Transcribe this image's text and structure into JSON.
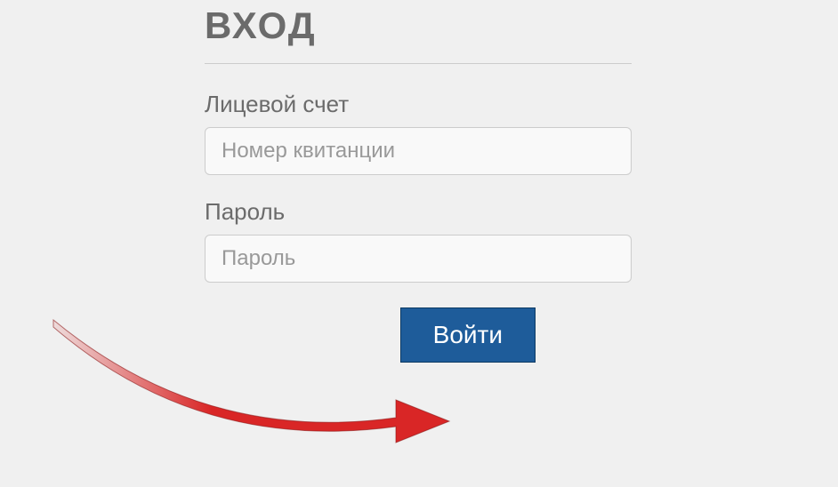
{
  "form": {
    "title": "ВХОД",
    "account": {
      "label": "Лицевой счет",
      "placeholder": "Номер квитанции",
      "value": ""
    },
    "password": {
      "label": "Пароль",
      "placeholder": "Пароль",
      "value": ""
    },
    "submit_label": "Войти"
  },
  "colors": {
    "primary_button": "#1e5c9a",
    "text_muted": "#6b6b6b",
    "arrow": "#d92626"
  }
}
